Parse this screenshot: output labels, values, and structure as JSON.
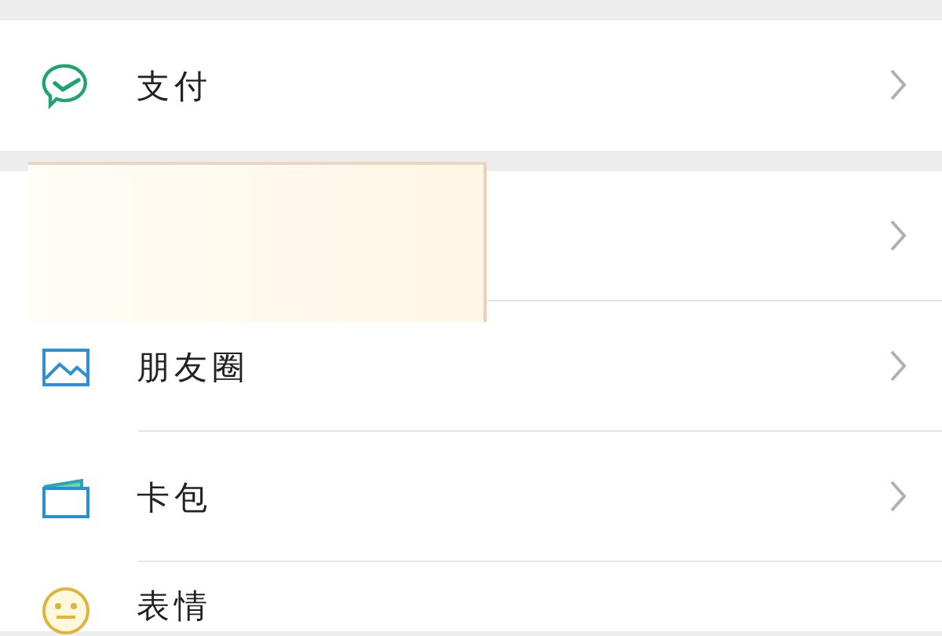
{
  "sections": [
    {
      "items": [
        {
          "kind": "pay",
          "label": "支付"
        }
      ]
    },
    {
      "items": [
        {
          "kind": "covered"
        },
        {
          "kind": "moments",
          "label": "朋友圈"
        },
        {
          "kind": "cards",
          "label": "卡包"
        },
        {
          "kind": "stickers",
          "label": "表情"
        }
      ]
    }
  ]
}
